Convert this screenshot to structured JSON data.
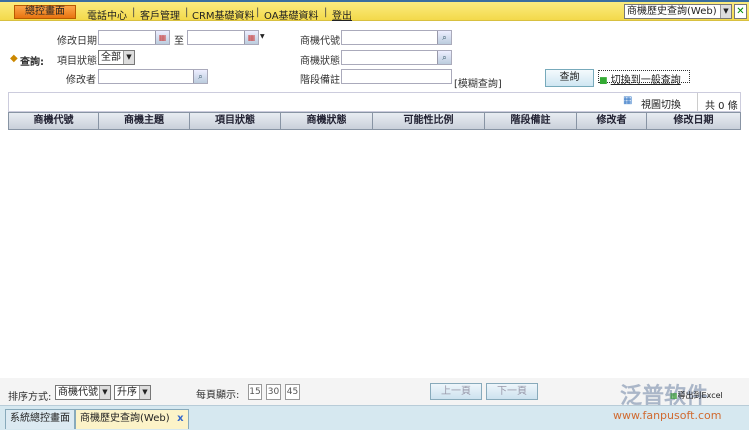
{
  "topbar": {
    "home": "總控畫面",
    "nav": [
      "電話中心",
      "客戶管理",
      "CRM基礎資料",
      "OA基礎資料",
      "登出"
    ],
    "page_select": "商機歷史查詢(Web)"
  },
  "query": {
    "title": "查詢:",
    "modify_date": "修改日期",
    "to": "至",
    "project_status": "項目狀態",
    "project_status_value": "全部",
    "modifier": "修改者",
    "opp_code": "商機代號",
    "opp_status": "商機狀態",
    "stage_note": "階段備註",
    "fuzzy": "[模糊查詢]",
    "search": "查詢",
    "switch": "切換到一般查詢"
  },
  "grid": {
    "view_switch": "視圖切換",
    "count": "共 0 條",
    "columns": [
      "商機代號",
      "商機主題",
      "項目狀態",
      "商機狀態",
      "可能性比例",
      "階段備註",
      "修改者",
      "修改日期"
    ]
  },
  "footer": {
    "sort_label": "排序方式:",
    "sort_field": "商機代號",
    "sort_order": "升序",
    "per_page": "每頁顯示:",
    "sizes": [
      "15",
      "30",
      "45"
    ],
    "prev": "上一頁",
    "next": "下一頁",
    "export": "導出到Excel"
  },
  "watermark": {
    "brand": "泛普软件",
    "url": "www.fanpusoft.com"
  },
  "tabs": [
    "系統總控畫面",
    "商機歷史查詢(Web)"
  ]
}
